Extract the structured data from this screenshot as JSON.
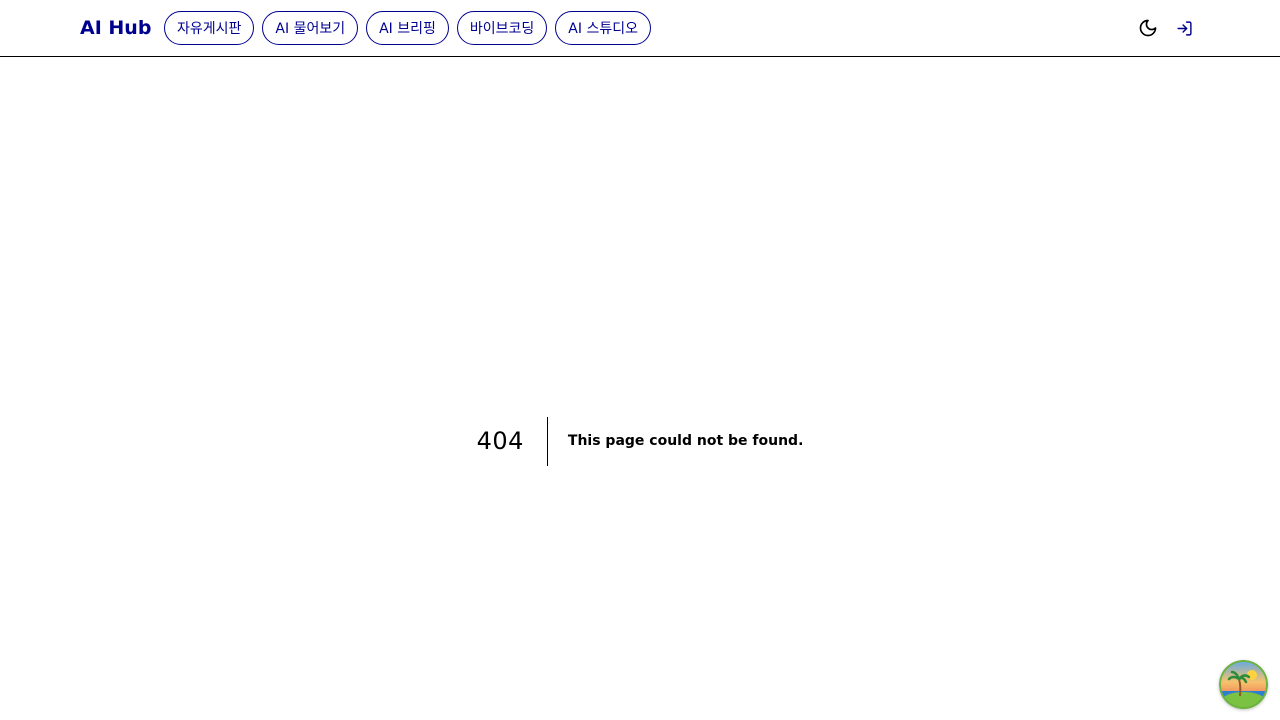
{
  "header": {
    "logo": "AI Hub",
    "nav": [
      {
        "label": "자유게시판"
      },
      {
        "label": "AI 물어보기"
      },
      {
        "label": "AI 브리핑"
      },
      {
        "label": "바이브코딩"
      },
      {
        "label": "AI 스튜디오"
      }
    ],
    "icons": {
      "theme": "moon-icon",
      "login": "login-icon"
    }
  },
  "error": {
    "code": "404",
    "message": "This page could not be found."
  },
  "colors": {
    "brand": "#000090",
    "border": "#000000",
    "background": "#ffffff"
  }
}
